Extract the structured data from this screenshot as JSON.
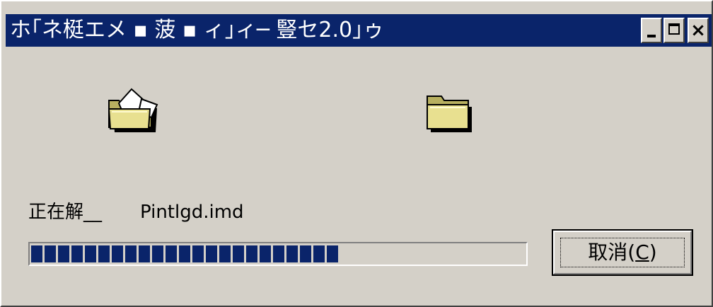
{
  "window": {
    "title": "ホ｢ネ梃エメ ▪ 菠 ▪ ィ｣ィ─ 豎セ2.0｣ゥ",
    "controls": {
      "minimize": "minimize",
      "maximize": "maximize",
      "close": "×"
    }
  },
  "icons": {
    "source": "open-folder-with-files-icon",
    "destination": "closed-folder-icon"
  },
  "status": {
    "label": "正在解__",
    "file": "Pintlgd.imd"
  },
  "progress": {
    "value": 0.63,
    "segments_filled": 23
  },
  "cancel_button": {
    "label_prefix": "取消(",
    "mnemonic": "C",
    "label_suffix": ")"
  },
  "colors": {
    "titlebar": "#0a246a",
    "face": "#d4d0c8",
    "progress": "#0a246a",
    "folder": "#e8e090"
  }
}
